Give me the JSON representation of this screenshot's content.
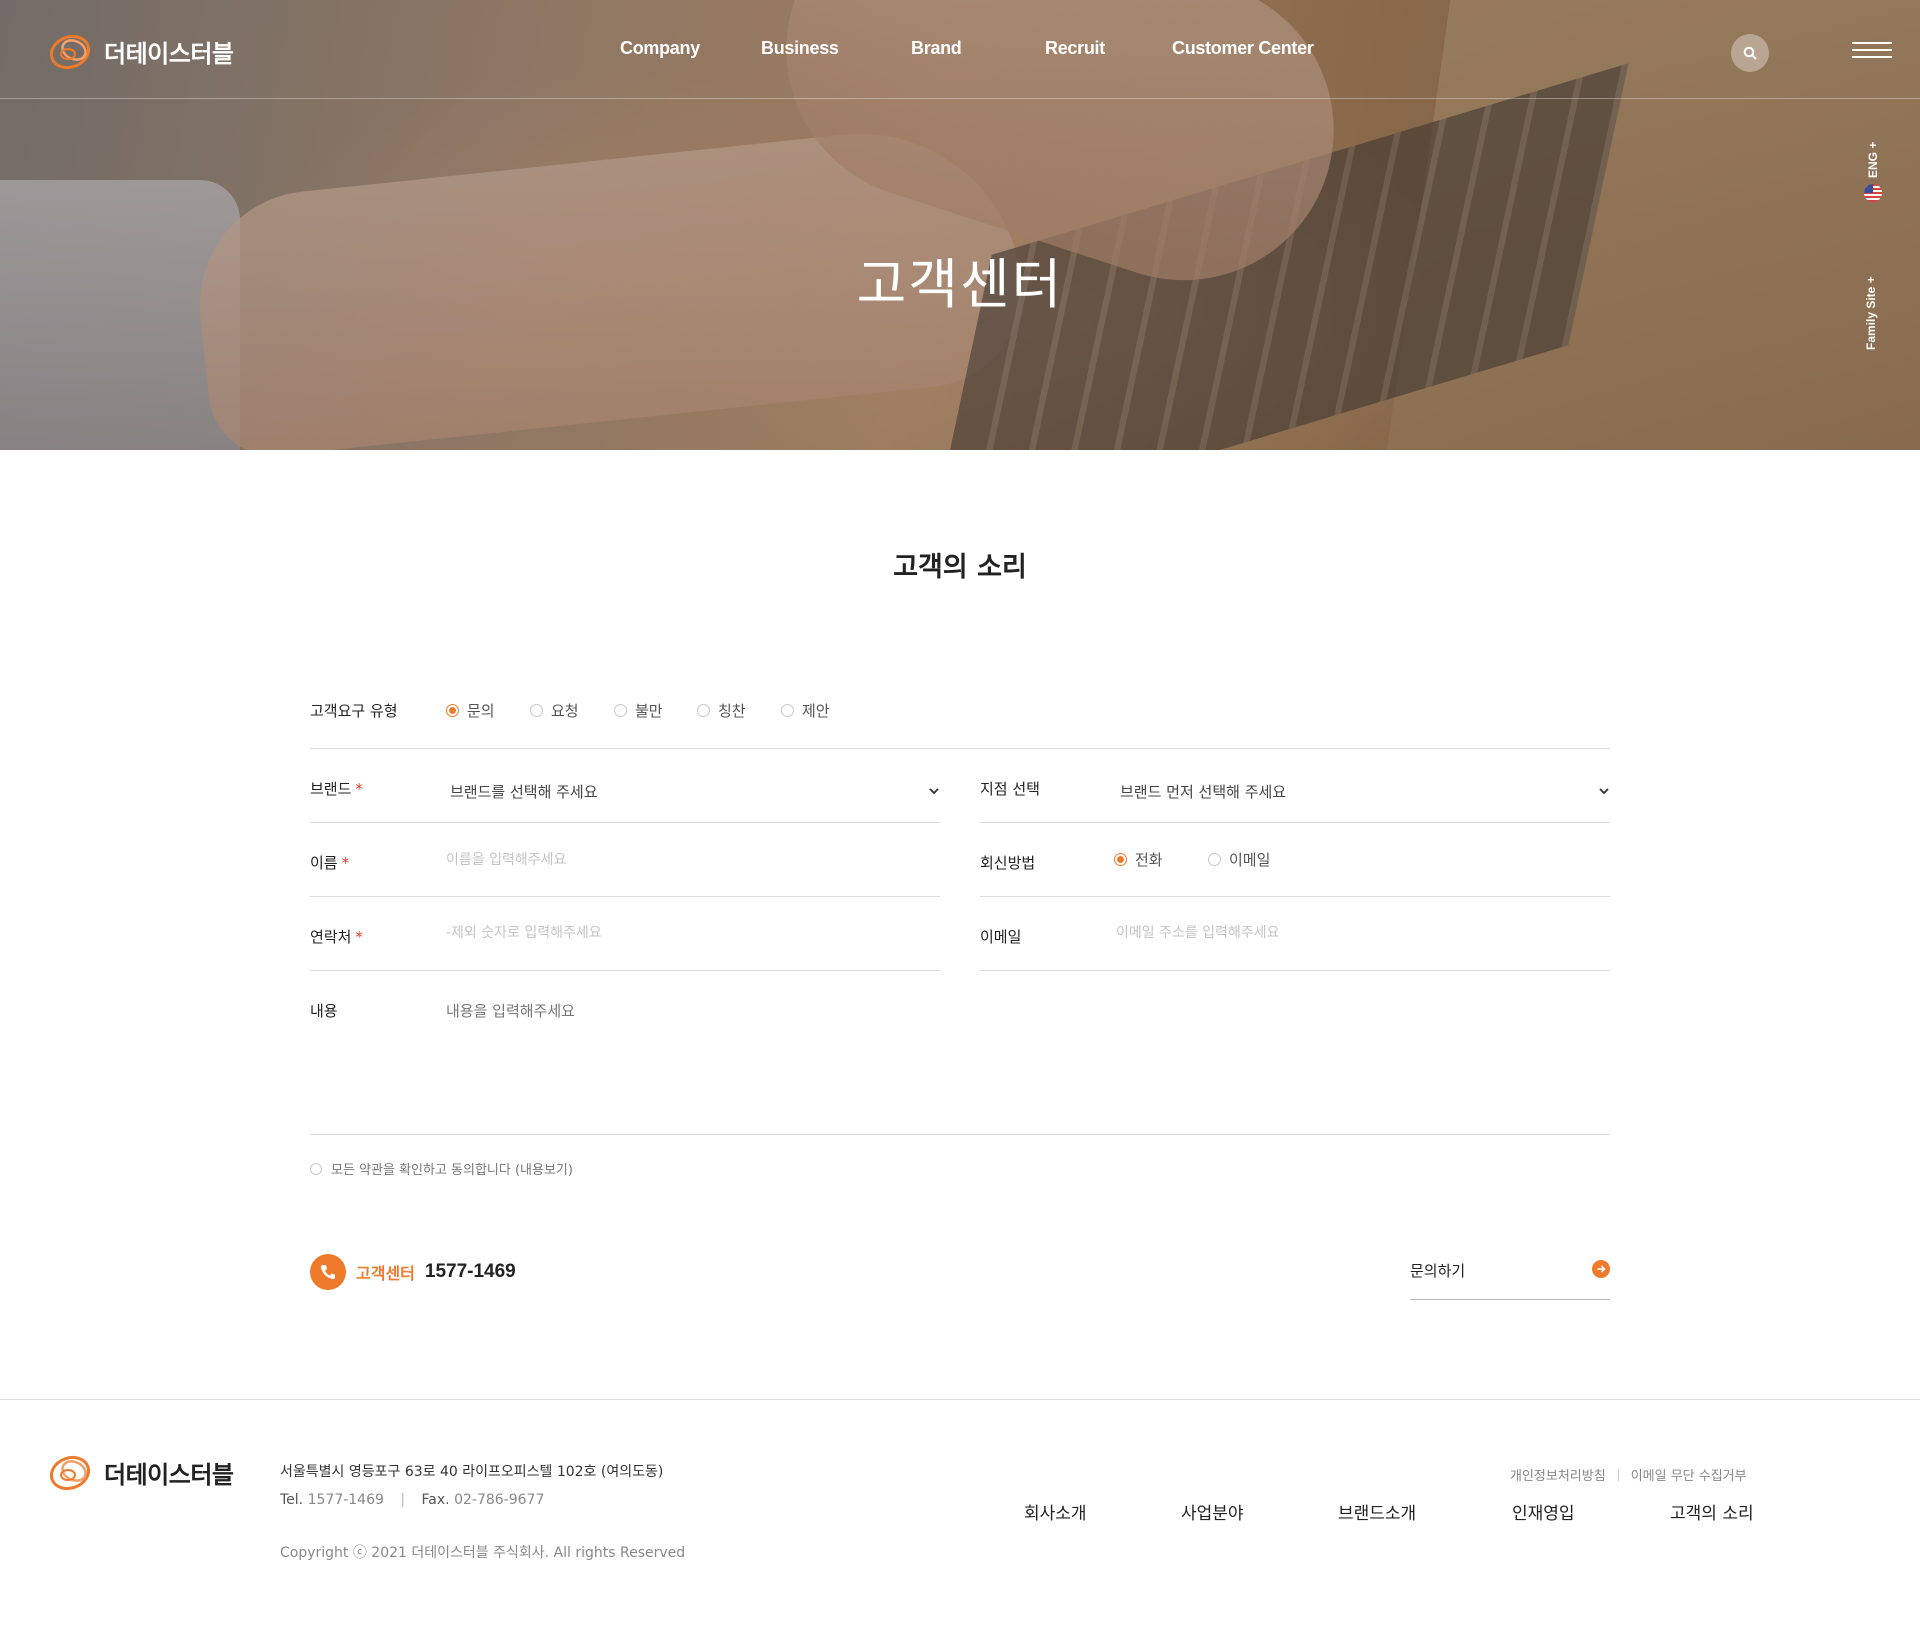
{
  "header": {
    "brand_name": "더테이스터블",
    "nav": [
      {
        "label": "Company"
      },
      {
        "label": "Business"
      },
      {
        "label": "Brand"
      },
      {
        "label": "Recruit"
      },
      {
        "label": "Customer Center"
      }
    ],
    "search_icon": "search-icon",
    "menu_icon": "hamburger-menu-icon",
    "side_links": {
      "language": "ENG +",
      "family_site": "Family Site +"
    }
  },
  "hero": {
    "title": "고객센터"
  },
  "main": {
    "section_title": "고객의 소리",
    "form": {
      "request_type": {
        "label": "고객요구 유형",
        "options": [
          "문의",
          "요청",
          "불만",
          "칭찬",
          "제안"
        ],
        "selected": "문의"
      },
      "brand": {
        "label": "브랜드",
        "required_mark": "*",
        "value": "브랜드를 선택해 주세요"
      },
      "branch": {
        "label": "지점 선택",
        "value": "브랜드 먼저 선택해 주세요"
      },
      "name": {
        "label": "이름",
        "required_mark": "*",
        "placeholder": "이름을 입력해주세요"
      },
      "reply_method": {
        "label": "회신방법",
        "options": [
          "전화",
          "이메일"
        ],
        "selected": "전화"
      },
      "contact": {
        "label": "연락처",
        "required_mark": "*",
        "placeholder": "-제외 숫자로 입력해주세요"
      },
      "email": {
        "label": "이메일",
        "placeholder": "이메일 주소를 입력해주세요"
      },
      "content": {
        "label": "내용",
        "placeholder": "내용을 입력해주세요"
      },
      "agree_text": "모든 약관을 확인하고 동의합니다 (내용보기)"
    },
    "call_center": {
      "label": "고객센터",
      "number": "1577-1469"
    },
    "submit_label": "문의하기"
  },
  "footer": {
    "brand_name": "더테이스터블",
    "address": "서울특별시 영등포구 63로 40 라이프오피스텔 102호 (여의도동)",
    "tel_label": "Tel.",
    "tel": "1577-1469",
    "fax_label": "Fax.",
    "fax": "02-786-9677",
    "copyright": "Copyright ⓒ 2021 더테이스터블 주식회사. All rights Reserved",
    "util_links": [
      "개인정보처리방침",
      "이메일 무단 수집거부"
    ],
    "nav": [
      "회사소개",
      "사업분야",
      "브랜드소개",
      "인재영입",
      "고객의 소리"
    ]
  },
  "colors": {
    "accent": "#f07a2c",
    "required": "#e0402e",
    "line": "#dcdcdc"
  }
}
